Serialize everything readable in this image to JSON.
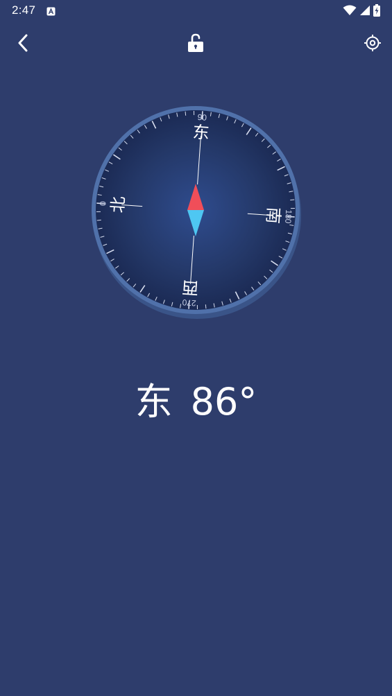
{
  "status_bar": {
    "time": "2:47",
    "icons": [
      "app-notification-icon",
      "wifi-icon",
      "signal-icon",
      "battery-charging-icon"
    ]
  },
  "app_bar": {
    "back_icon": "chevron-left-icon",
    "lock_icon": "unlocked-padlock-icon",
    "locate_icon": "crosshair-target-icon"
  },
  "compass": {
    "heading_degrees": 86,
    "directions": {
      "north": "北",
      "east": "东",
      "south": "南",
      "west": "西"
    },
    "degree_labels": {
      "north": "0",
      "east": "90",
      "south": "180",
      "west": "270"
    },
    "colors": {
      "needle_north": "#f04e59",
      "needle_south": "#4ec7f2",
      "bezel": "#4f6fa8",
      "face_center": "#2e4a8a",
      "face_edge": "#1c2b55"
    }
  },
  "readout": {
    "direction": "东",
    "degrees": "86°"
  },
  "colors": {
    "background": "#2e3d6c"
  }
}
